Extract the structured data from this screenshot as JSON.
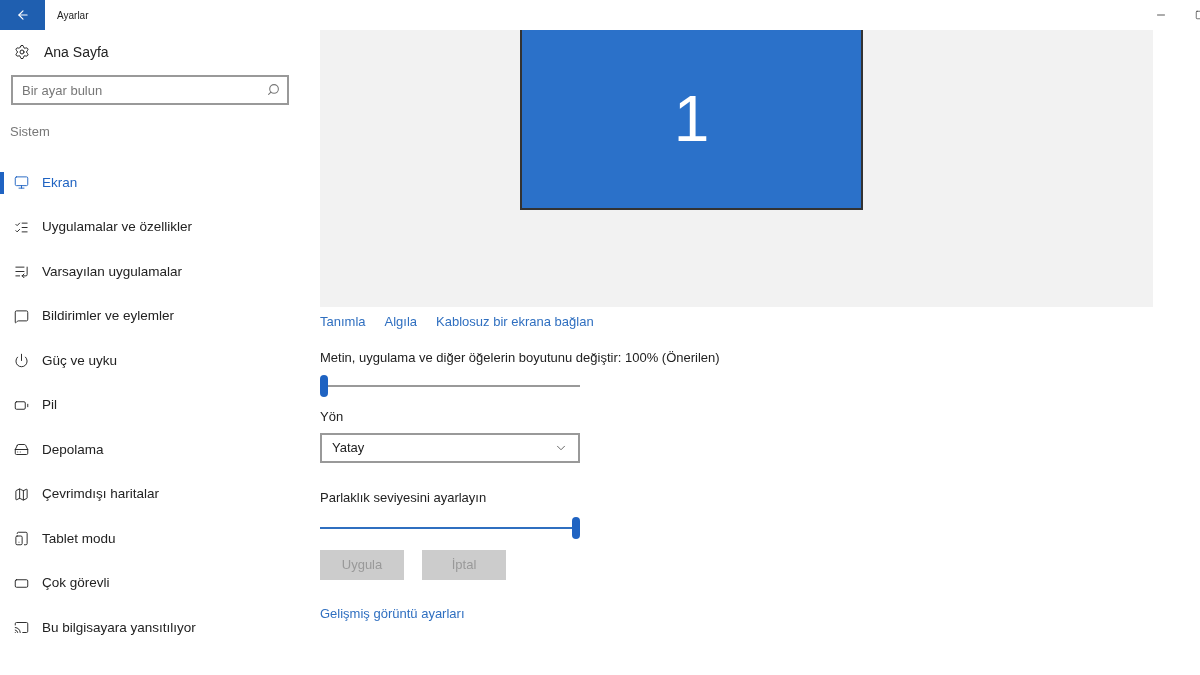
{
  "window": {
    "title": "Ayarlar"
  },
  "sidebar": {
    "home": "Ana Sayfa",
    "search": {
      "placeholder": "Bir ayar bulun"
    },
    "section": "Sistem",
    "items": [
      {
        "label": "Ekran",
        "selected": true
      },
      {
        "label": "Uygulamalar ve özellikler",
        "selected": false
      },
      {
        "label": "Varsayılan uygulamalar",
        "selected": false
      },
      {
        "label": "Bildirimler ve eylemler",
        "selected": false
      },
      {
        "label": "Güç ve uyku",
        "selected": false
      },
      {
        "label": "Pil",
        "selected": false
      },
      {
        "label": "Depolama",
        "selected": false
      },
      {
        "label": "Çevrimdışı haritalar",
        "selected": false
      },
      {
        "label": "Tablet modu",
        "selected": false
      },
      {
        "label": "Çok görevli",
        "selected": false
      },
      {
        "label": "Bu bilgisayara yansıtılıyor",
        "selected": false
      }
    ]
  },
  "display": {
    "monitor": "1",
    "links": [
      "Tanımla",
      "Algıla",
      "Kablosuz bir ekrana bağlan"
    ],
    "scale": {
      "label": "Metin, uygulama ve diğer öğelerin boyutunu değiştir: 100% (Önerilen)",
      "level": 0
    },
    "orientation": {
      "label": "Yön",
      "value": "Yatay"
    },
    "brightness": {
      "label": "Parlaklık seviyesini ayarlayın",
      "level": 1
    },
    "buttons": [
      {
        "label": "Uygula",
        "disabled": true
      },
      {
        "label": "İptal",
        "disabled": true
      }
    ],
    "advanced_link": "Gelişmiş görüntü ayarları"
  }
}
